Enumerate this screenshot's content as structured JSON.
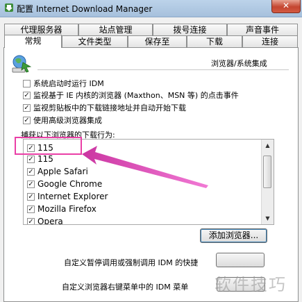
{
  "window": {
    "title": "配置 Internet Download Manager",
    "close_glyph": "✕",
    "app_icon": "idm-app-icon"
  },
  "tabs_row1": [
    "代理服务器",
    "站点管理",
    "拨号连接",
    "声音事件"
  ],
  "tabs_row2": [
    "常规",
    "文件类型",
    "保存至",
    "下载",
    "连接"
  ],
  "active_tab": "常规",
  "section": {
    "title": "浏览器/系统集成",
    "icon": "browser-integration-globe-icon"
  },
  "options": [
    {
      "label": "系统启动时运行 IDM",
      "checked": false
    },
    {
      "label": "监视基于 IE 内核的浏览器 (Maxthon、MSN 等) 的点击事件",
      "checked": true
    },
    {
      "label": "监视剪贴板中的下载链接地址并自动开始下载",
      "checked": true
    },
    {
      "label": "使用高级浏览器集成",
      "checked": true
    }
  ],
  "browser_list": {
    "label": "捕获以下浏览器的下载行为:",
    "items": [
      {
        "label": "115",
        "checked": true
      },
      {
        "label": "115",
        "checked": true
      },
      {
        "label": "Apple Safari",
        "checked": true
      },
      {
        "label": "Google Chrome",
        "checked": true
      },
      {
        "label": "Internet Explorer",
        "checked": true
      },
      {
        "label": "Mozilla Firefox",
        "checked": true
      },
      {
        "label": "Opera",
        "checked": true
      }
    ]
  },
  "add_browser_label": "添加浏览器...",
  "custom_text_1": "自定义暂停调用或强制调用 IDM 的快捷",
  "custom_text_2": "自定义浏览器右键菜单中的 IDM 菜单",
  "watermark": "软件技巧",
  "colors": {
    "annotation": "#ea3fa6",
    "accent": "#3c7fb1"
  }
}
